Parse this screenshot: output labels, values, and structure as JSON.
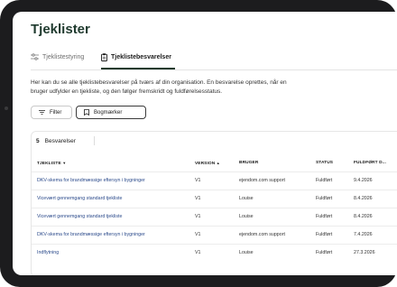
{
  "page": {
    "title": "Tjeklister"
  },
  "tabs": [
    {
      "label": "Tjeklistestyring",
      "icon": "list-settings-icon"
    },
    {
      "label": "Tjeklistebesvarelser",
      "icon": "clipboard-icon"
    }
  ],
  "description": "Her kan du se alle tjeklistebesvarelser på tværs af din organisation. En besvarelse oprettes, når en bruger udfylder en tjekliste, og den følger fremskridt og fuldførelsesstatus.",
  "buttons": {
    "filter": "Filter",
    "bookmarks": "Bogmærker"
  },
  "table": {
    "count": "5",
    "label": "Besvarelser",
    "columns": [
      "TJEKLISTE",
      "VERSION",
      "BRUGER",
      "STATUS",
      "FULDFØRT D..."
    ],
    "rows": [
      {
        "checklist": "DKV-skema for brandmæssige eftersyn i bygninger",
        "version": "V1",
        "user": "ejendom.com support",
        "status": "Fuldført",
        "completed": "9.4.2026"
      },
      {
        "checklist": "Vicevært gennemgang standard tjekliste",
        "version": "V1",
        "user": "Louise",
        "status": "Fuldført",
        "completed": "8.4.2026"
      },
      {
        "checklist": "Vicevært gennemgang standard tjekliste",
        "version": "V1",
        "user": "Louise",
        "status": "Fuldført",
        "completed": "8.4.2026"
      },
      {
        "checklist": "DKV-skema for brandmæssige eftersyn i bygninger",
        "version": "V1",
        "user": "ejendom.com support",
        "status": "Fuldført",
        "completed": "7.4.2026"
      },
      {
        "checklist": "Indflytning",
        "version": "V1",
        "user": "Louise",
        "status": "Fuldført",
        "completed": "27.3.2026"
      }
    ]
  }
}
